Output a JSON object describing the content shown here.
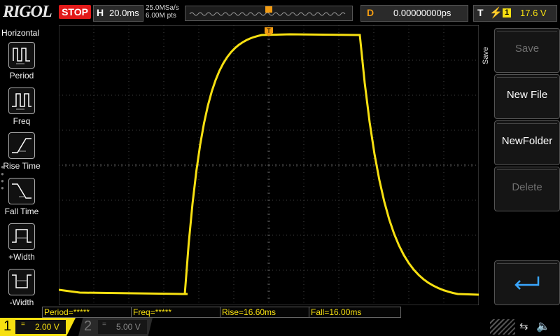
{
  "top": {
    "brand": "RIGOL",
    "run_state": "STOP",
    "h_label": "H",
    "timebase": "20.0ms",
    "sample_rate": "25.0MSa/s",
    "memory_depth": "6.00M pts",
    "delay_label": "D",
    "delay_value": "0.00000000ps",
    "trigger_label": "T",
    "trigger_edge": "rising-edge-icon",
    "trigger_source": "1",
    "trigger_level": "17.6 V"
  },
  "left_menu": {
    "title": "Horizontal",
    "items": [
      {
        "label": "Period",
        "icon": "period-icon"
      },
      {
        "label": "Freq",
        "icon": "freq-icon"
      },
      {
        "label": "Rise Time",
        "icon": "rise-time-icon"
      },
      {
        "label": "Fall Time",
        "icon": "fall-time-icon"
      },
      {
        "label": "+Width",
        "icon": "positive-width-icon"
      },
      {
        "label": "-Width",
        "icon": "negative-width-icon"
      }
    ]
  },
  "right_menu": {
    "title": "Save",
    "buttons": [
      {
        "label": "Save",
        "enabled": false
      },
      {
        "label": "New File",
        "enabled": true
      },
      {
        "label": "NewFolder",
        "enabled": true
      },
      {
        "label": "Delete",
        "enabled": false
      },
      {
        "label": "",
        "icon": "return-icon",
        "enabled": true
      }
    ]
  },
  "measurements": {
    "period": "Period=*****",
    "freq": "Freq=*****",
    "rise": "Rise=16.60ms",
    "fall": "Fall=16.00ms"
  },
  "channels": {
    "ch1": {
      "number": "1",
      "coupling": "=",
      "scale": "2.00 V",
      "color": "#f7e011"
    },
    "ch2": {
      "number": "2",
      "coupling": "=",
      "scale": "5.00 V",
      "color": "#777777"
    }
  },
  "waveform": {
    "marker": "1",
    "trigger_marker": "T",
    "color": "#f7e011"
  },
  "status_icons": [
    "usb-icon",
    "speaker-muted-icon"
  ]
}
